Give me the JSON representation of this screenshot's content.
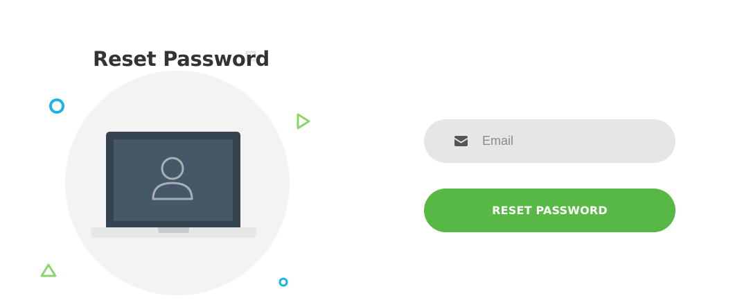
{
  "form": {
    "title": "Reset Password",
    "email": {
      "placeholder": "Email",
      "value": "",
      "icon": "envelope-icon"
    },
    "submit_label": "RESET PASSWORD"
  },
  "illustration": {
    "icons": [
      "laptop-icon",
      "user-icon"
    ]
  },
  "colors": {
    "accent": "#57b846",
    "field_bg": "#e6e6e6",
    "title": "#333333",
    "decor_blue": "#1ab2e8",
    "decor_green": "#8bd469",
    "circle_bg": "#f3f3f3",
    "laptop_frame": "#354250",
    "laptop_screen": "#465867"
  }
}
